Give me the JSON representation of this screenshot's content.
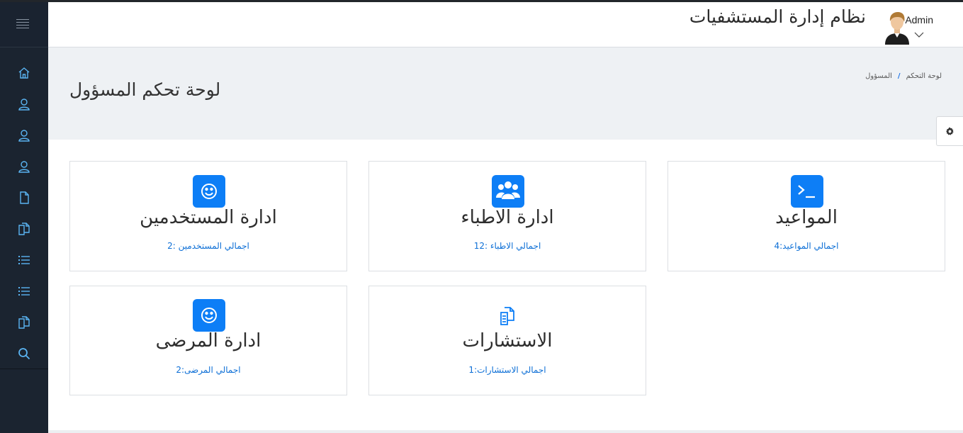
{
  "header": {
    "app_title": "نظام إدارة المستشفيات",
    "user_name": "Admin"
  },
  "sidebar": {
    "items": [
      {
        "icon": "home-icon"
      },
      {
        "icon": "user-icon"
      },
      {
        "icon": "user-icon"
      },
      {
        "icon": "user-icon"
      },
      {
        "icon": "file-icon"
      },
      {
        "icon": "files-icon"
      },
      {
        "icon": "list-icon"
      },
      {
        "icon": "list-icon"
      },
      {
        "icon": "files-icon"
      },
      {
        "icon": "search-icon"
      }
    ]
  },
  "breadcrumb": {
    "home": "لوحة التحكم",
    "current": "المسؤول"
  },
  "page": {
    "title": "لوحة تحكم المسؤول"
  },
  "cards": {
    "appointments": {
      "title": "المواعيد",
      "stat": "اجمالي المواعيد:4",
      "icon": "terminal-icon"
    },
    "doctors": {
      "title": "ادارة الاطباء",
      "stat": "اجمالي الاطباء :12",
      "icon": "users-icon"
    },
    "users": {
      "title": "ادارة المستخدمين",
      "stat": "اجمالي المستخدمين :2",
      "icon": "smile-icon"
    },
    "consultations": {
      "title": "الاستشارات",
      "stat": "اجمالي الاستشارات:1",
      "icon": "files-icon"
    },
    "patients": {
      "title": "ادارة المرضى",
      "stat": "اجمالي المرضى:2",
      "icon": "smile-icon"
    }
  },
  "colors": {
    "sidebar_bg": "#1b2430",
    "accent": "#0d7ef6",
    "link": "#0d6fd6",
    "page_head_bg": "#eef1f4"
  }
}
